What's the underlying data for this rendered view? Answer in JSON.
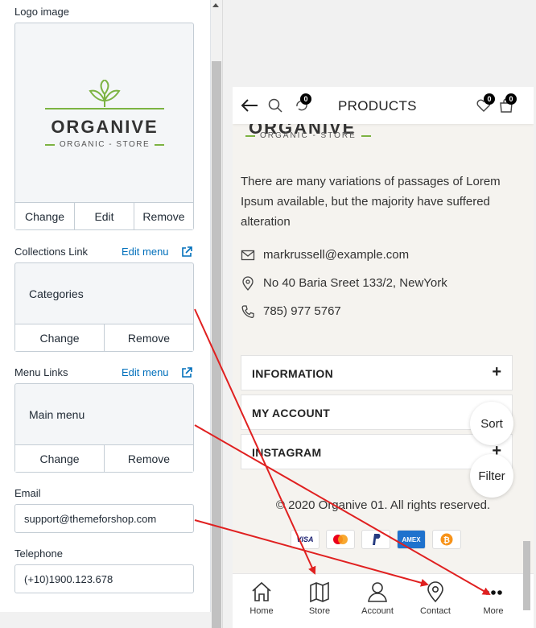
{
  "settings": {
    "logo_label": "Logo image",
    "logo_buttons": {
      "change": "Change",
      "edit": "Edit",
      "remove": "Remove"
    },
    "logo_preview": {
      "name": "ORGANIVE",
      "tagline": "ORGANIC - STORE"
    },
    "collections": {
      "label": "Collections Link",
      "edit_link": "Edit menu",
      "value": "Categories",
      "change": "Change",
      "remove": "Remove"
    },
    "menu_links": {
      "label": "Menu Links",
      "edit_link": "Edit menu",
      "value": "Main menu",
      "change": "Change",
      "remove": "Remove"
    },
    "email": {
      "label": "Email",
      "value": "support@themeforshop.com"
    },
    "telephone": {
      "label": "Telephone",
      "value": "(+10)1900.123.678"
    }
  },
  "preview": {
    "header": {
      "title": "PRODUCTS",
      "compare_count": "0",
      "wishlist_count": "0",
      "cart_count": "0"
    },
    "brand": {
      "name_cut": "ORGANIVE",
      "tagline": "ORGANIC - STORE"
    },
    "description": "There are many variations of passages of Lorem Ipsum available, but the majority have suffered alteration",
    "contact": {
      "email": "markrussell@example.com",
      "address": "No 40 Baria Sreet 133/2, NewYork",
      "phone": "785) 977 5767"
    },
    "accordion": [
      {
        "label": "INFORMATION",
        "toggle": "+"
      },
      {
        "label": "MY ACCOUNT",
        "toggle": "+"
      },
      {
        "label": "INSTAGRAM",
        "toggle": "+"
      }
    ],
    "floating": {
      "sort": "Sort",
      "filter": "Filter"
    },
    "copyright": "© 2020 Organive 01. All rights reserved.",
    "payments": [
      "VISA",
      "mastercard",
      "PayPal",
      "AMEX",
      "bitcoin"
    ],
    "bottom_nav": [
      {
        "label": "Home",
        "icon": "home-icon"
      },
      {
        "label": "Store",
        "icon": "map-icon"
      },
      {
        "label": "Account",
        "icon": "user-icon"
      },
      {
        "label": "Contact",
        "icon": "location-pin-icon"
      },
      {
        "label": "More",
        "icon": "more-dots-icon"
      }
    ]
  },
  "colors": {
    "link": "#006fbb",
    "brand_green": "#7cb342",
    "arrow": "#e02020"
  }
}
